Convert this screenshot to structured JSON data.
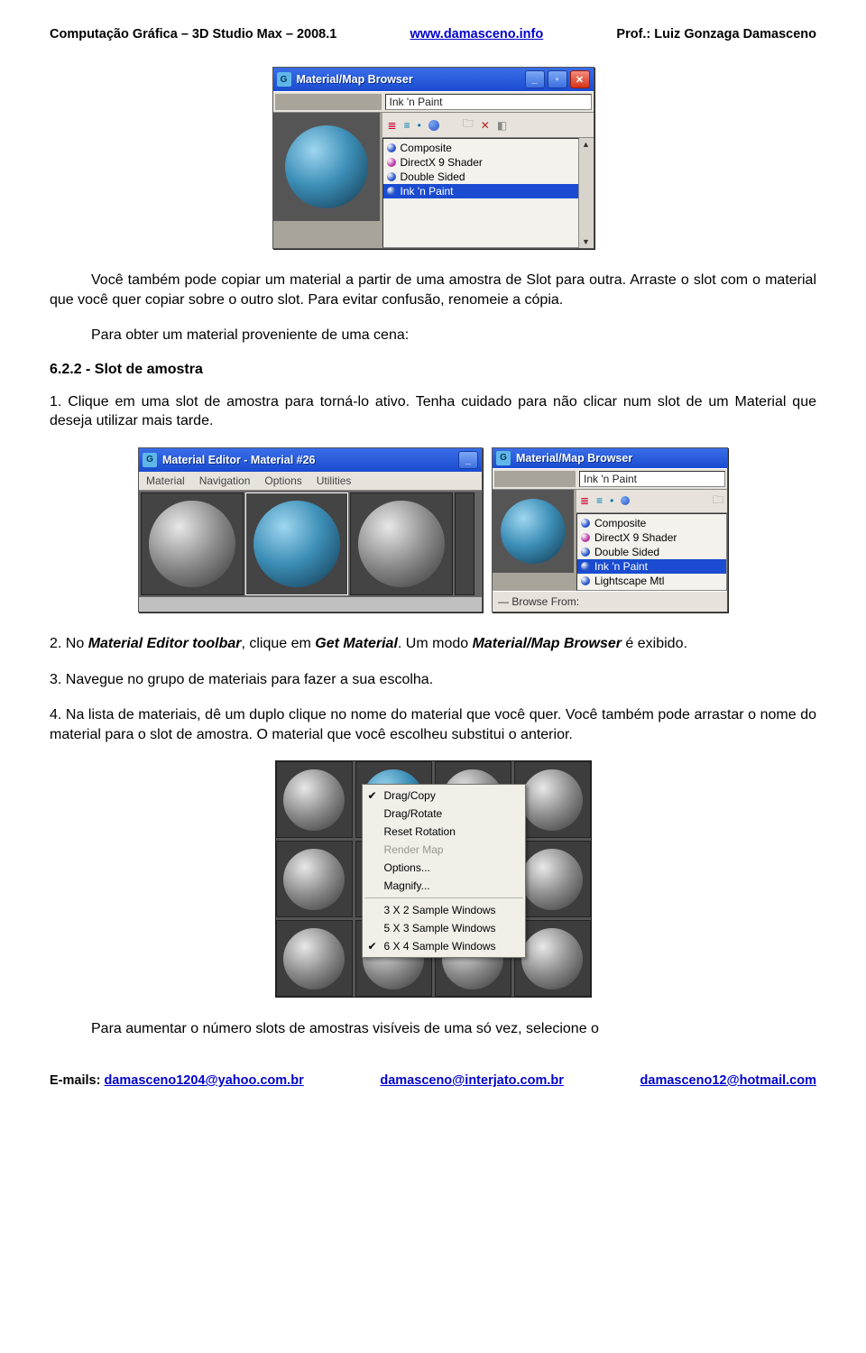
{
  "header": {
    "left": "Computação Gráfica – 3D Studio Max – 2008.1",
    "center": "www.damasceno.info",
    "right": "Prof.: Luiz Gonzaga Damasceno"
  },
  "footer": {
    "label": "E-mails:",
    "email1": "damasceno1204@yahoo.com.br",
    "email2": "damasceno@interjato.com.br",
    "email3": "damasceno12@hotmail.com"
  },
  "fig1": {
    "title": "Material/Map Browser",
    "addr": "Ink 'n Paint",
    "items": [
      {
        "label": "Composite",
        "color": "#2b55c9"
      },
      {
        "label": "DirectX 9 Shader",
        "color": "#b93aa7"
      },
      {
        "label": "Double Sided",
        "color": "#2b55c9"
      },
      {
        "label": "Ink 'n Paint",
        "color": "#2b55c9",
        "sel": "1"
      }
    ]
  },
  "para1": "Você também pode copiar um material a partir de uma amostra de Slot para outra. Arraste o slot com o material que você quer copiar sobre o outro slot. Para evitar confusão, renomeie a cópia.",
  "para2": "Para obter um material proveniente de uma cena:",
  "section622": "6.2.2 - Slot de amostra",
  "para3": "1. Clique em uma slot de amostra para torná-lo ativo. Tenha cuidado para não clicar num slot de um Material que deseja utilizar mais tarde.",
  "fig2": {
    "left": {
      "title": "Material Editor - Material #26",
      "menu": [
        "Material",
        "Navigation",
        "Options",
        "Utilities"
      ]
    },
    "right": {
      "title": "Material/Map Browser",
      "addr": "Ink 'n Paint",
      "items": [
        {
          "label": "Composite",
          "color": "#2b55c9"
        },
        {
          "label": "DirectX 9 Shader",
          "color": "#b93aa7"
        },
        {
          "label": "Double Sided",
          "color": "#2b55c9"
        },
        {
          "label": "Ink 'n Paint",
          "color": "#2b55c9",
          "sel": "1"
        },
        {
          "label": "Lightscape Mtl",
          "color": "#2b55c9"
        }
      ],
      "browseFrom": "Browse From:"
    }
  },
  "para4_pre": "2. No ",
  "para4_b1": "Material Editor toolbar",
  "para4_mid1": ", clique em ",
  "para4_b2": "Get Material",
  "para4_mid2": ". Um modo ",
  "para4_b3": "Material/Map Browser",
  "para4_post": " é exibido.",
  "para5": "3. Navegue no grupo de materiais para fazer a sua escolha.",
  "para6": "4. Na lista de materiais, dê um duplo clique no nome do material que você quer. Você também pode arrastar o nome do material para o slot de amostra. O material que você escolheu substitui o anterior.",
  "fig3": {
    "menu": {
      "dragcopy": "Drag/Copy",
      "dragrotate": "Drag/Rotate",
      "resetrotation": "Reset Rotation",
      "rendermap": "Render Map",
      "options": "Options...",
      "magnify": "Magnify...",
      "w3x2": "3 X 2 Sample Windows",
      "w5x3": "5 X 3 Sample Windows",
      "w6x4": "6 X 4 Sample Windows"
    }
  },
  "para7": "Para aumentar o número slots de amostras visíveis de uma só vez, selecione o"
}
